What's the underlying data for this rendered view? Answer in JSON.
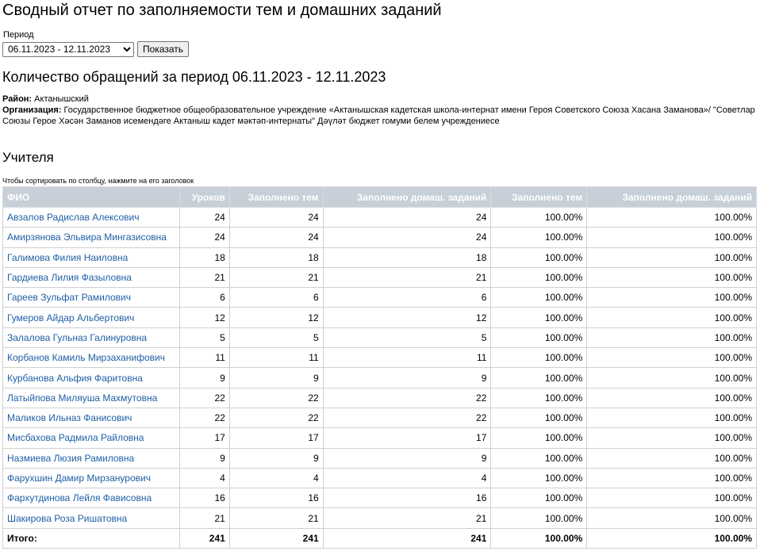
{
  "page": {
    "title": "Сводный отчет по заполняемости тем и домашних заданий",
    "period_label": "Период",
    "period_value": "06.11.2023 - 12.11.2023",
    "show_button": "Показать",
    "count_heading": "Количество обращений за период 06.11.2023 - 12.11.2023",
    "district_label": "Район:",
    "district_value": "Актанышский",
    "org_label": "Организация:",
    "org_value": "Государственное бюджетное общеобразовательное учреждение «Актанышская кадетская школа-интернат имени Героя Советского Союза Хасана Заманова»/ \"Советлар Союзы Герое Хәсән Заманов исемендәге Актаныш кадет мәктәп-интернаты\" Дәүләт бюджет гомуми белем учреждениесе",
    "teachers_heading": "Учителя",
    "sort_hint": "Чтобы сортировать по столбцу, нажмите на его заголовок"
  },
  "table": {
    "headers": [
      "ФИО",
      "Уроков",
      "Заполнено тем",
      "Заполнено домаш. заданий",
      "Заполнено тем",
      "Заполнено домаш. заданий"
    ],
    "rows": [
      [
        "Авзалов Радислав Алексович",
        "24",
        "24",
        "24",
        "100.00%",
        "100.00%"
      ],
      [
        "Амирзянова Эльвира Мингазисовна",
        "24",
        "24",
        "24",
        "100.00%",
        "100.00%"
      ],
      [
        "Галимова Филия Наиловна",
        "18",
        "18",
        "18",
        "100.00%",
        "100.00%"
      ],
      [
        "Гардиева Лилия Фазыловна",
        "21",
        "21",
        "21",
        "100.00%",
        "100.00%"
      ],
      [
        "Гареев Зульфат Рамилович",
        "6",
        "6",
        "6",
        "100.00%",
        "100.00%"
      ],
      [
        "Гумеров Айдар Альбертович",
        "12",
        "12",
        "12",
        "100.00%",
        "100.00%"
      ],
      [
        "Залалова Гульназ Галинуровна",
        "5",
        "5",
        "5",
        "100.00%",
        "100.00%"
      ],
      [
        "Корбанов Камиль Мирзаханифович",
        "11",
        "11",
        "11",
        "100.00%",
        "100.00%"
      ],
      [
        "Курбанова Альфия Фаритовна",
        "9",
        "9",
        "9",
        "100.00%",
        "100.00%"
      ],
      [
        "Латыйпова Миляуша Махмутовна",
        "22",
        "22",
        "22",
        "100.00%",
        "100.00%"
      ],
      [
        "Маликов Ильназ Фанисович",
        "22",
        "22",
        "22",
        "100.00%",
        "100.00%"
      ],
      [
        "Мисбахова Радмила Райловна",
        "17",
        "17",
        "17",
        "100.00%",
        "100.00%"
      ],
      [
        "Назмиева Люзия Рамиловна",
        "9",
        "9",
        "9",
        "100.00%",
        "100.00%"
      ],
      [
        "Фарухшин Дамир Мирзанурович",
        "4",
        "4",
        "4",
        "100.00%",
        "100.00%"
      ],
      [
        "Фархутдинова Лейля Фависовна",
        "16",
        "16",
        "16",
        "100.00%",
        "100.00%"
      ],
      [
        "Шакирова Роза Ришатовна",
        "21",
        "21",
        "21",
        "100.00%",
        "100.00%"
      ]
    ],
    "total": [
      "Итого:",
      "241",
      "241",
      "241",
      "100.00%",
      "100.00%"
    ]
  },
  "colors": {
    "header_bg": "#c7cfd9",
    "link": "#1f5fa6"
  }
}
